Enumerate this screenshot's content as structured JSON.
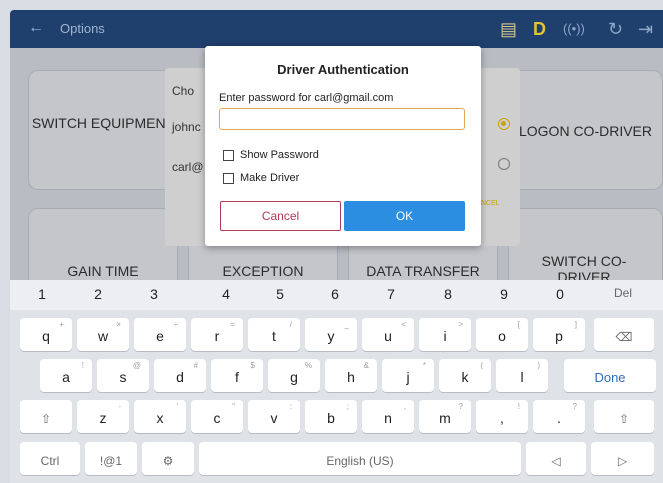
{
  "appbar": {
    "title": "Options",
    "icons": [
      "back-arrow-icon",
      "message-icon",
      "driver-d-icon",
      "signal-icon",
      "refresh-icon",
      "logout-icon"
    ],
    "d_label": "D"
  },
  "background": {
    "tiles": [
      {
        "label": "SWITCH EQUIPMENT"
      },
      {
        "label": "LOGON CO-DRIVER"
      },
      {
        "label": "GAIN TIME"
      },
      {
        "label": "EXCEPTION"
      },
      {
        "label": "DATA TRANSFER"
      },
      {
        "label": "SWITCH CO-DRIVER"
      }
    ],
    "chooser_title": "Cho",
    "chooser_items": [
      "johnc",
      "carl@"
    ],
    "chooser_cancel": "NCEL"
  },
  "dialog": {
    "title": "Driver Authentication",
    "prompt": "Enter password for carl@gmail.com",
    "password_value": "",
    "show_password_label": "Show Password",
    "make_driver_label": "Make Driver",
    "cancel_label": "Cancel",
    "ok_label": "OK"
  },
  "keyboard": {
    "numbers": [
      "1",
      "2",
      "3",
      "4",
      "5",
      "6",
      "7",
      "8",
      "9",
      "0"
    ],
    "del_label": "Del",
    "row1": [
      {
        "k": "q",
        "s": "+"
      },
      {
        "k": "w",
        "s": "×"
      },
      {
        "k": "e",
        "s": "÷"
      },
      {
        "k": "r",
        "s": "="
      },
      {
        "k": "t",
        "s": "/"
      },
      {
        "k": "y",
        "s": "_"
      },
      {
        "k": "u",
        "s": "<"
      },
      {
        "k": "i",
        "s": ">"
      },
      {
        "k": "o",
        "s": "["
      },
      {
        "k": "p",
        "s": "]"
      }
    ],
    "row2": [
      {
        "k": "a",
        "s": "!"
      },
      {
        "k": "s",
        "s": "@"
      },
      {
        "k": "d",
        "s": "#"
      },
      {
        "k": "f",
        "s": "$"
      },
      {
        "k": "g",
        "s": "%"
      },
      {
        "k": "h",
        "s": "&"
      },
      {
        "k": "j",
        "s": "*"
      },
      {
        "k": "k",
        "s": "("
      },
      {
        "k": "l",
        "s": ")"
      }
    ],
    "done_label": "Done",
    "row3": [
      {
        "k": "z",
        "s": "-"
      },
      {
        "k": "x",
        "s": "'"
      },
      {
        "k": "c",
        "s": "\""
      },
      {
        "k": "v",
        "s": ":"
      },
      {
        "k": "b",
        "s": ";"
      },
      {
        "k": "n",
        "s": ","
      },
      {
        "k": "m",
        "s": "?"
      }
    ],
    "comma": ",",
    "comma_sub": "!",
    "period": ".",
    "period_sub": "?",
    "ctrl_label": "Ctrl",
    "sym_label": "!@1",
    "space_label": "English (US)"
  }
}
